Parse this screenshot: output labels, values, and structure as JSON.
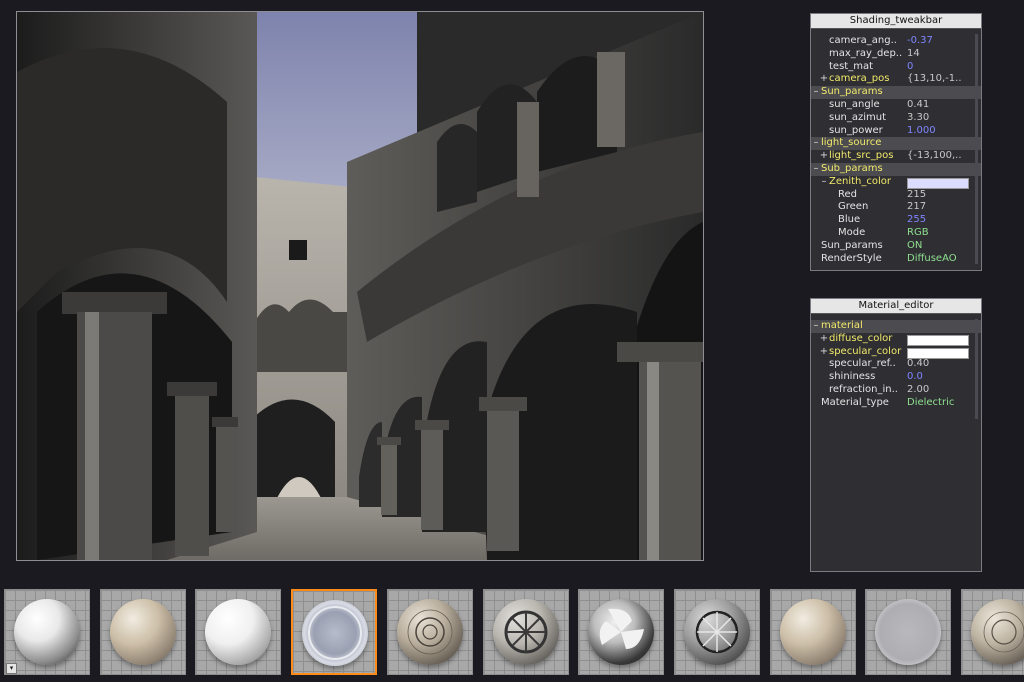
{
  "shading_tweakbar": {
    "title": "Shading_tweakbar",
    "rows": [
      {
        "label": "camera_ang..",
        "value": "-0.37",
        "kind": "param",
        "value_color": "blue"
      },
      {
        "label": "max_ray_dep..",
        "value": "14",
        "kind": "param",
        "value_color": "lightgray"
      },
      {
        "label": "test_mat",
        "value": "0",
        "kind": "param",
        "value_color": "blue"
      },
      {
        "label": "camera_pos",
        "value": "{13,10,-1..",
        "kind": "subparam",
        "expander": "+",
        "value_color": "lightgray"
      },
      {
        "label": "Sun_params",
        "value": "",
        "kind": "group",
        "expander": "–"
      },
      {
        "label": "sun_angle",
        "value": "0.41",
        "kind": "param",
        "value_color": "lightgray"
      },
      {
        "label": "sun_azimut",
        "value": "3.30",
        "kind": "param",
        "value_color": "lightgray"
      },
      {
        "label": "sun_power",
        "value": "1.000",
        "kind": "param",
        "value_color": "blue"
      },
      {
        "label": "light_source",
        "value": "",
        "kind": "group",
        "expander": "–"
      },
      {
        "label": "light_src_pos",
        "value": "{-13,100,..",
        "kind": "subparam",
        "expander": "+",
        "value_color": "lightgray"
      },
      {
        "label": "Sub_params",
        "value": "",
        "kind": "group",
        "expander": "–"
      },
      {
        "label": "Zenith_color",
        "value": "",
        "kind": "color",
        "expander": "–",
        "swatch": "#dcdcff"
      },
      {
        "label": "Red",
        "value": "215",
        "kind": "channel",
        "value_color": "lightgray"
      },
      {
        "label": "Green",
        "value": "217",
        "kind": "channel",
        "value_color": "lightgray"
      },
      {
        "label": "Blue",
        "value": "255",
        "kind": "channel",
        "value_color": "blue"
      },
      {
        "label": "Mode",
        "value": "RGB",
        "kind": "channel",
        "value_color": "green"
      },
      {
        "label": "Sun_params",
        "value": "ON",
        "kind": "top",
        "value_color": "green"
      },
      {
        "label": "RenderStyle",
        "value": "DiffuseAO",
        "kind": "top",
        "value_color": "green"
      }
    ]
  },
  "material_editor": {
    "title": "Material_editor",
    "rows": [
      {
        "label": "material",
        "value": "",
        "kind": "group",
        "expander": "–"
      },
      {
        "label": "diffuse_color",
        "value": "",
        "kind": "color",
        "expander": "+",
        "swatch": "#ffffff"
      },
      {
        "label": "specular_color",
        "value": "",
        "kind": "color",
        "expander": "+",
        "swatch": "#ffffff"
      },
      {
        "label": "specular_ref..",
        "value": "0.40",
        "kind": "param",
        "value_color": "lightgray"
      },
      {
        "label": "shininess",
        "value": "0.0",
        "kind": "param",
        "value_color": "blue"
      },
      {
        "label": "refraction_in..",
        "value": "2.00",
        "kind": "param",
        "value_color": "lightgray"
      },
      {
        "label": "Material_type",
        "value": "Dielectric",
        "kind": "top",
        "value_color": "green"
      }
    ]
  },
  "viewport": {
    "scene": "sponza-atrium-render",
    "sky_color": "#8f93b8"
  },
  "materials": [
    {
      "name": "white-diffuse",
      "style": "plain-white",
      "selected": false
    },
    {
      "name": "beige-stone",
      "style": "stone",
      "selected": false
    },
    {
      "name": "white-glossy",
      "style": "plain-white-soft",
      "selected": false
    },
    {
      "name": "glass",
      "style": "glass",
      "selected": true
    },
    {
      "name": "ornament-medallion",
      "style": "ornament",
      "selected": false
    },
    {
      "name": "wheel-metal",
      "style": "wheel",
      "selected": false
    },
    {
      "name": "fan-blades",
      "style": "fan",
      "selected": false
    },
    {
      "name": "wheel-spokes",
      "style": "spokes",
      "selected": false
    },
    {
      "name": "sandstone",
      "style": "stone",
      "selected": false
    },
    {
      "name": "transparent-glass",
      "style": "faint",
      "selected": false
    },
    {
      "name": "tile-pattern",
      "style": "tile",
      "selected": false
    }
  ],
  "colors": {
    "accent_selected": "#ff8c1a",
    "group_header": "#f2ea6a",
    "value_blue": "#7f86ff",
    "value_green": "#8fe08f"
  }
}
